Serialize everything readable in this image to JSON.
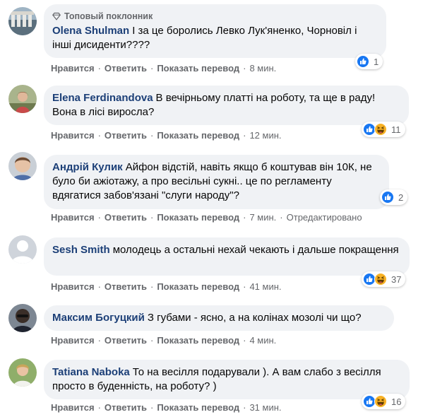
{
  "comments": [
    {
      "badge": "Топовый поклонник",
      "author": "Olena Shulman",
      "text": "І за це боролись Левко Лук'яненко, Чорновіл і інші дисиденти????",
      "reactions": [
        "like"
      ],
      "reaction_count": "1",
      "actions": [
        "Нравится",
        "Ответить",
        "Показать перевод"
      ],
      "time": "8 мин.",
      "edited": ""
    },
    {
      "badge": "",
      "author": "Elena Ferdinandova",
      "text": "В вечірньому платті на роботу, та ще в раду! Вона в лісі виросла?",
      "reactions": [
        "like",
        "haha"
      ],
      "reaction_count": "11",
      "actions": [
        "Нравится",
        "Ответить",
        "Показать перевод"
      ],
      "time": "12 мин.",
      "edited": ""
    },
    {
      "badge": "",
      "author": "Андрій Кулик",
      "text": "Айфон відстій, навіть якщо б коштував він 10К, не було би ажіотажу, а про весільні сукні.. це по регламенту вдягатися забов'язані \"слуги народу\"?",
      "reactions": [
        "like"
      ],
      "reaction_count": "2",
      "actions": [
        "Нравится",
        "Ответить",
        "Показать перевод"
      ],
      "time": "7 мин.",
      "edited": "Отредактировано"
    },
    {
      "badge": "",
      "author": "Sesh Smith",
      "text": "молодець а остальні нехай чекають і дальше покращення",
      "reactions": [
        "like",
        "haha"
      ],
      "reaction_count": "37",
      "actions": [
        "Нравится",
        "Ответить",
        "Показать перевод"
      ],
      "time": "41 мин.",
      "edited": ""
    },
    {
      "badge": "",
      "author": "Максим Богуцкий",
      "text": "З губами - ясно, а на колінах мозолі чи що?",
      "reactions": [],
      "reaction_count": "",
      "actions": [
        "Нравится",
        "Ответить",
        "Показать перевод"
      ],
      "time": "4 мин.",
      "edited": ""
    },
    {
      "badge": "",
      "author": "Tatiana Naboka",
      "text": "То на весілля подарували ). А вам слабо з весілля просто в буденність, на роботу? )",
      "reactions": [
        "like",
        "haha"
      ],
      "reaction_count": "16",
      "actions": [
        "Нравится",
        "Ответить",
        "Показать перевод"
      ],
      "time": "31 мин.",
      "edited": ""
    }
  ],
  "colors": {
    "bubble": "#f0f2f5",
    "author": "#1c3f77",
    "meta": "#65676b",
    "like": "#1877f2",
    "haha": "#f7b125"
  },
  "icons": {
    "badge": "diamond-icon",
    "like": "like-reaction-icon",
    "haha": "haha-reaction-icon",
    "default_avatar": "default-avatar-icon"
  }
}
